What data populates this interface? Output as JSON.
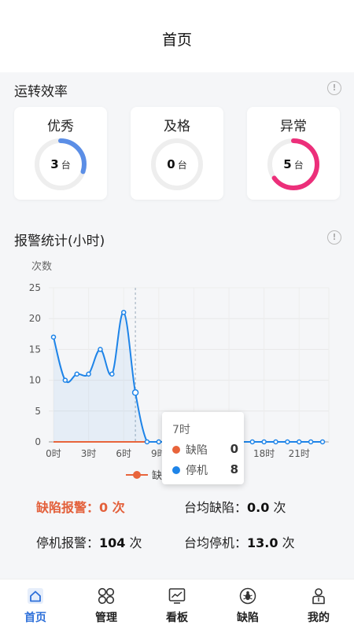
{
  "header": {
    "title": "首页"
  },
  "efficiency": {
    "title": "运转效率",
    "cards": [
      {
        "label": "优秀",
        "value": "3",
        "unit": "台",
        "progress": 0.3,
        "color": "#5b8ee6"
      },
      {
        "label": "及格",
        "value": "0",
        "unit": "台",
        "progress": 0,
        "color": "#5b8ee6"
      },
      {
        "label": "异常",
        "value": "5",
        "unit": "台",
        "progress": 0.65,
        "color": "#ec2f7a"
      }
    ]
  },
  "alarm": {
    "title": "报警统计(小时)"
  },
  "chart_data": {
    "type": "line",
    "ylabel": "次数",
    "ylim": [
      0,
      25
    ],
    "yticks": [
      0,
      5,
      10,
      15,
      20,
      25
    ],
    "x": [
      0,
      1,
      2,
      3,
      4,
      5,
      6,
      7,
      8,
      9,
      10,
      11,
      12,
      13,
      14,
      15,
      16,
      17,
      18,
      19,
      20,
      21,
      22,
      23
    ],
    "xtick_labels": [
      "0时",
      "3时",
      "6时",
      "9时",
      "12时",
      "15时",
      "18时",
      "21时"
    ],
    "series": [
      {
        "name": "缺陷",
        "color": "#e8643b",
        "values": [
          0,
          0,
          0,
          0,
          0,
          0,
          0,
          0,
          0,
          0,
          0,
          0,
          0,
          0,
          0,
          0,
          0,
          0,
          0,
          0,
          0,
          0,
          0,
          0
        ]
      },
      {
        "name": "停机",
        "color": "#1e84e8",
        "values": [
          17,
          10,
          11,
          11,
          15,
          11,
          21,
          8,
          0,
          0,
          0,
          0,
          0,
          0,
          0,
          0,
          0,
          0,
          0,
          0,
          0,
          0,
          0,
          0
        ]
      }
    ],
    "legend_label": "缺",
    "grid": true,
    "tooltip": {
      "title": "7时",
      "rows": [
        {
          "name": "缺陷",
          "value": "0",
          "color": "#e8643b"
        },
        {
          "name": "停机",
          "value": "8",
          "color": "#1e84e8"
        }
      ]
    }
  },
  "stats": {
    "defect_alarm_label": "缺陷报警：",
    "defect_alarm_value": "0",
    "defect_alarm_unit": "次",
    "avg_defect_label": "台均缺陷：",
    "avg_defect_value": "0.0",
    "avg_defect_unit": "次",
    "stop_alarm_label": "停机报警：",
    "stop_alarm_value": "104",
    "stop_alarm_unit": "次",
    "avg_stop_label": "台均停机：",
    "avg_stop_value": "13.0",
    "avg_stop_unit": "次"
  },
  "tabs": [
    {
      "label": "首页",
      "icon": "home-icon",
      "active": true
    },
    {
      "label": "管理",
      "icon": "grid-icon",
      "active": false
    },
    {
      "label": "看板",
      "icon": "chart-board-icon",
      "active": false
    },
    {
      "label": "缺陷",
      "icon": "bug-icon",
      "active": false
    },
    {
      "label": "我的",
      "icon": "person-icon",
      "active": false
    }
  ]
}
